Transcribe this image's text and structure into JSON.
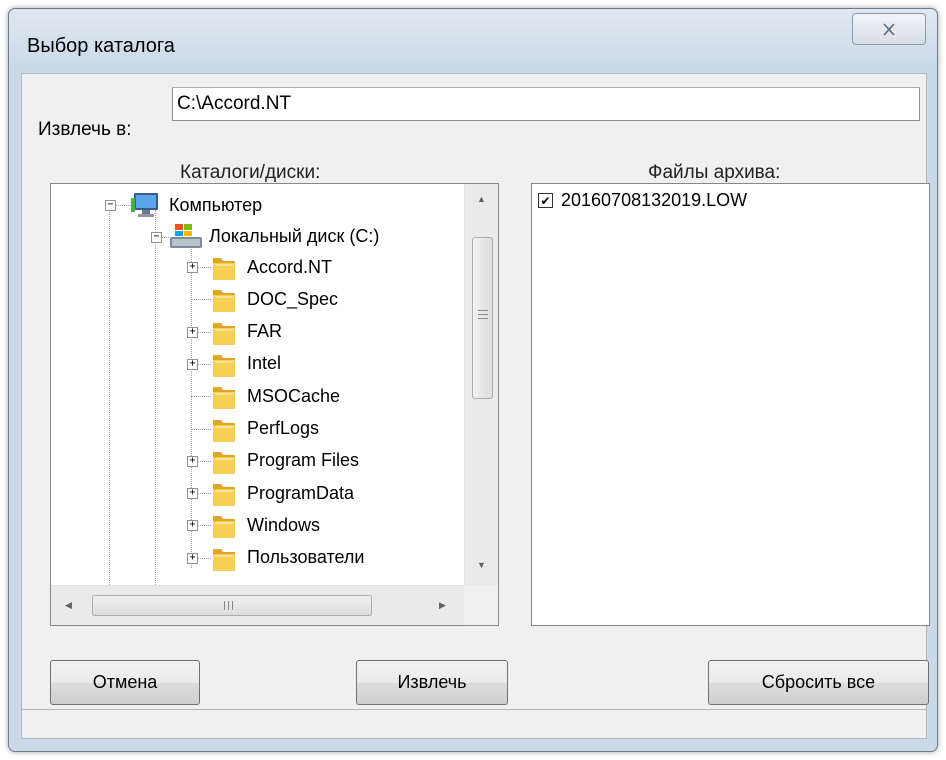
{
  "window": {
    "title": "Выбор каталога"
  },
  "extract_to": {
    "label": "Извлечь в:",
    "value": "C:\\Accord.NT"
  },
  "tree": {
    "header": "Каталоги/диски:",
    "computer": "Компьютер",
    "drive": "Локальный диск (C:)",
    "folders": [
      {
        "name": "Accord.NT",
        "expandable": true
      },
      {
        "name": "DOC_Spec",
        "expandable": false
      },
      {
        "name": "FAR",
        "expandable": true
      },
      {
        "name": "Intel",
        "expandable": true
      },
      {
        "name": "MSOCache",
        "expandable": false
      },
      {
        "name": "PerfLogs",
        "expandable": false
      },
      {
        "name": "Program Files",
        "expandable": true
      },
      {
        "name": "ProgramData",
        "expandable": true
      },
      {
        "name": "Windows",
        "expandable": true
      },
      {
        "name": "Пользователи",
        "expandable": true
      }
    ]
  },
  "files": {
    "header": "Файлы архива:",
    "items": [
      {
        "name": "20160708132019.LOW",
        "checked": true
      }
    ]
  },
  "buttons": {
    "cancel": "Отмена",
    "extract": "Извлечь",
    "reset": "Сбросить все"
  },
  "icons": {
    "close": "close-icon",
    "computer": "computer-icon",
    "drive": "drive-icon",
    "folder": "folder-icon"
  }
}
